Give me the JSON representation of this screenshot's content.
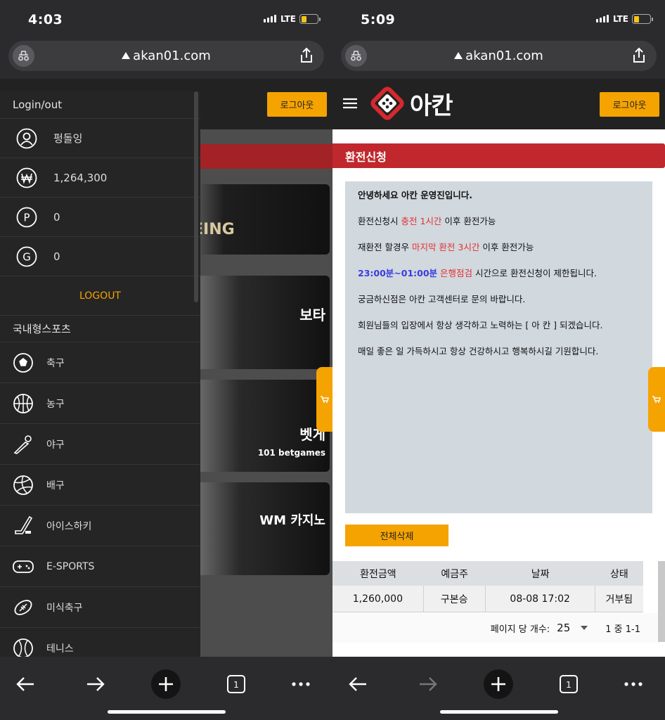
{
  "left": {
    "time": "4:03",
    "network": "LTE",
    "url": "akan01.com",
    "logout_btn": "로그아웃",
    "drawer": {
      "section_login": "Login/out",
      "username": "펑돌잉",
      "balance": "1,264,300",
      "points": "0",
      "g_value": "0",
      "logout": "LOGOUT",
      "section_sports": "국내형스포츠",
      "sports": [
        "축구",
        "농구",
        "야구",
        "배구",
        "아이스하키",
        "E-SPORTS",
        "미식축구",
        "테니스"
      ]
    },
    "games": [
      {
        "label": "EING"
      },
      {
        "label": "보타"
      },
      {
        "label": "벳게",
        "sub": "101 betgames"
      },
      {
        "label": "WM 카지노"
      }
    ]
  },
  "right": {
    "time": "5:09",
    "network": "LTE",
    "url": "akan01.com",
    "brand": "아칸",
    "logout_btn": "로그아웃",
    "page_title": "환전신청",
    "notice": {
      "greeting": "안녕하세요 아칸 운영진입니다.",
      "l2a": "환전신청시 ",
      "l2b": "충전 1시간",
      "l2c": " 이후 환전가능",
      "l3a": "재환전 할경우 ",
      "l3b": "마지막 환전 3시간",
      "l3c": " 이후 환전가능",
      "l4a": "23:00분~01:00분",
      "l4b": " 은행점검",
      "l4c": " 시간으로 환전신청이 제한됩니다.",
      "l5": "궁금하신점은 아칸 고객센터로 문의 바랍니다.",
      "l6": "회원님들의 입장에서 항상 생각하고 노력하는 [ 아 칸 ] 되겠습니다.",
      "l7": "매일 좋은 일 가득하시고 항상 건강하시고 행복하시길 기원합니다."
    },
    "delete_all": "전체삭제",
    "table": {
      "headers": [
        "환전금액",
        "예금주",
        "날짜",
        "상태"
      ],
      "row": [
        "1,260,000",
        "구본승",
        "08-08 17:02",
        "거부됨"
      ]
    },
    "pager": {
      "label": "페이지 당 개수:",
      "per_page": "25",
      "range": "1 중 1-1"
    }
  },
  "tabs_count": "1",
  "colors": {
    "accent": "#f5a300",
    "red": "#c0282d",
    "dark": "#222222"
  }
}
